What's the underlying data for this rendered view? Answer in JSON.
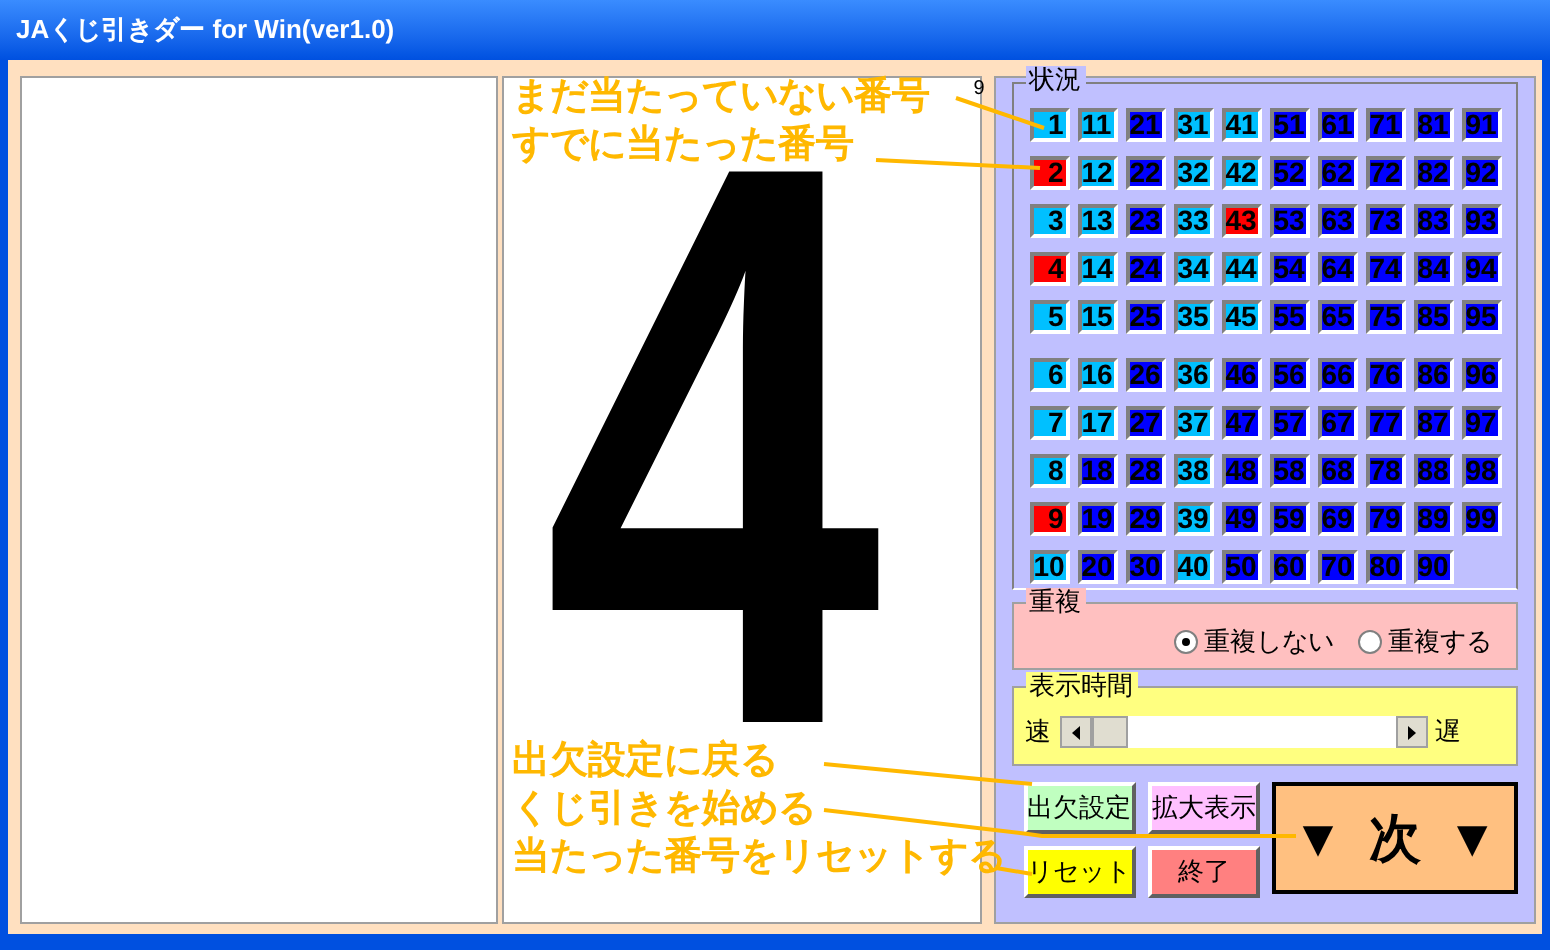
{
  "window": {
    "title": "JAくじ引きダー for Win(ver1.0)"
  },
  "display": {
    "number": "4",
    "edge_label": "9"
  },
  "annotations": [
    {
      "text": "まだ当たっていない番号"
    },
    {
      "text": "すでに当たった番号"
    },
    {
      "text": "出欠設定に戻る"
    },
    {
      "text": "くじ引きを始める"
    },
    {
      "text": "当たった番号をリセットする"
    }
  ],
  "status": {
    "title": "状況",
    "groups": [
      [
        [
          {
            "label": "1",
            "color": "#00c0ff"
          },
          {
            "label": "11",
            "color": "#00c0ff"
          },
          {
            "label": "21",
            "color": "#0000ff"
          },
          {
            "label": "31",
            "color": "#00c0ff"
          },
          {
            "label": "41",
            "color": "#00c0ff"
          },
          {
            "label": "51",
            "color": "#0000ff"
          },
          {
            "label": "61",
            "color": "#0000ff"
          },
          {
            "label": "71",
            "color": "#0000ff"
          },
          {
            "label": "81",
            "color": "#0000ff"
          },
          {
            "label": "91",
            "color": "#0000ff"
          }
        ],
        [
          {
            "label": "2",
            "color": "#ff0000"
          },
          {
            "label": "12",
            "color": "#00c0ff"
          },
          {
            "label": "22",
            "color": "#0000ff"
          },
          {
            "label": "32",
            "color": "#00c0ff"
          },
          {
            "label": "42",
            "color": "#00c0ff"
          },
          {
            "label": "52",
            "color": "#0000ff"
          },
          {
            "label": "62",
            "color": "#0000ff"
          },
          {
            "label": "72",
            "color": "#0000ff"
          },
          {
            "label": "82",
            "color": "#0000ff"
          },
          {
            "label": "92",
            "color": "#0000ff"
          }
        ],
        [
          {
            "label": "3",
            "color": "#00c0ff"
          },
          {
            "label": "13",
            "color": "#00c0ff"
          },
          {
            "label": "23",
            "color": "#0000ff"
          },
          {
            "label": "33",
            "color": "#00c0ff"
          },
          {
            "label": "43",
            "color": "#ff0000"
          },
          {
            "label": "53",
            "color": "#0000ff"
          },
          {
            "label": "63",
            "color": "#0000ff"
          },
          {
            "label": "73",
            "color": "#0000ff"
          },
          {
            "label": "83",
            "color": "#0000ff"
          },
          {
            "label": "93",
            "color": "#0000ff"
          }
        ],
        [
          {
            "label": "4",
            "color": "#ff0000"
          },
          {
            "label": "14",
            "color": "#00c0ff"
          },
          {
            "label": "24",
            "color": "#0000ff"
          },
          {
            "label": "34",
            "color": "#00c0ff"
          },
          {
            "label": "44",
            "color": "#00c0ff"
          },
          {
            "label": "54",
            "color": "#0000ff"
          },
          {
            "label": "64",
            "color": "#0000ff"
          },
          {
            "label": "74",
            "color": "#0000ff"
          },
          {
            "label": "84",
            "color": "#0000ff"
          },
          {
            "label": "94",
            "color": "#0000ff"
          }
        ],
        [
          {
            "label": "5",
            "color": "#00c0ff"
          },
          {
            "label": "15",
            "color": "#00c0ff"
          },
          {
            "label": "25",
            "color": "#0000ff"
          },
          {
            "label": "35",
            "color": "#00c0ff"
          },
          {
            "label": "45",
            "color": "#00c0ff"
          },
          {
            "label": "55",
            "color": "#0000ff"
          },
          {
            "label": "65",
            "color": "#0000ff"
          },
          {
            "label": "75",
            "color": "#0000ff"
          },
          {
            "label": "85",
            "color": "#0000ff"
          },
          {
            "label": "95",
            "color": "#0000ff"
          }
        ]
      ],
      [
        [
          {
            "label": "6",
            "color": "#00c0ff"
          },
          {
            "label": "16",
            "color": "#00c0ff"
          },
          {
            "label": "26",
            "color": "#0000ff"
          },
          {
            "label": "36",
            "color": "#00c0ff"
          },
          {
            "label": "46",
            "color": "#0000ff"
          },
          {
            "label": "56",
            "color": "#0000ff"
          },
          {
            "label": "66",
            "color": "#0000ff"
          },
          {
            "label": "76",
            "color": "#0000ff"
          },
          {
            "label": "86",
            "color": "#0000ff"
          },
          {
            "label": "96",
            "color": "#0000ff"
          }
        ],
        [
          {
            "label": "7",
            "color": "#00c0ff"
          },
          {
            "label": "17",
            "color": "#00c0ff"
          },
          {
            "label": "27",
            "color": "#0000ff"
          },
          {
            "label": "37",
            "color": "#00c0ff"
          },
          {
            "label": "47",
            "color": "#0000ff"
          },
          {
            "label": "57",
            "color": "#0000ff"
          },
          {
            "label": "67",
            "color": "#0000ff"
          },
          {
            "label": "77",
            "color": "#0000ff"
          },
          {
            "label": "87",
            "color": "#0000ff"
          },
          {
            "label": "97",
            "color": "#0000ff"
          }
        ],
        [
          {
            "label": "8",
            "color": "#00c0ff"
          },
          {
            "label": "18",
            "color": "#0000ff"
          },
          {
            "label": "28",
            "color": "#0000ff"
          },
          {
            "label": "38",
            "color": "#00c0ff"
          },
          {
            "label": "48",
            "color": "#0000ff"
          },
          {
            "label": "58",
            "color": "#0000ff"
          },
          {
            "label": "68",
            "color": "#0000ff"
          },
          {
            "label": "78",
            "color": "#0000ff"
          },
          {
            "label": "88",
            "color": "#0000ff"
          },
          {
            "label": "98",
            "color": "#0000ff"
          }
        ],
        [
          {
            "label": "9",
            "color": "#ff0000"
          },
          {
            "label": "19",
            "color": "#0000ff"
          },
          {
            "label": "29",
            "color": "#0000ff"
          },
          {
            "label": "39",
            "color": "#00c0ff"
          },
          {
            "label": "49",
            "color": "#0000ff"
          },
          {
            "label": "59",
            "color": "#0000ff"
          },
          {
            "label": "69",
            "color": "#0000ff"
          },
          {
            "label": "79",
            "color": "#0000ff"
          },
          {
            "label": "89",
            "color": "#0000ff"
          },
          {
            "label": "99",
            "color": "#0000ff"
          }
        ],
        [
          {
            "label": "10",
            "color": "#00c0ff"
          },
          {
            "label": "20",
            "color": "#0000ff"
          },
          {
            "label": "30",
            "color": "#0000ff"
          },
          {
            "label": "40",
            "color": "#00c0ff"
          },
          {
            "label": "50",
            "color": "#0000ff"
          },
          {
            "label": "60",
            "color": "#0000ff"
          },
          {
            "label": "70",
            "color": "#0000ff"
          },
          {
            "label": "80",
            "color": "#0000ff"
          },
          {
            "label": "90",
            "color": "#0000ff"
          }
        ]
      ]
    ]
  },
  "duplicate": {
    "title": "重複",
    "options": [
      {
        "label": "重複しない",
        "selected": true
      },
      {
        "label": "重複する",
        "selected": false
      }
    ]
  },
  "display_time": {
    "title": "表示時間",
    "fast_label": "速",
    "slow_label": "遅",
    "level": 0
  },
  "buttons": [
    {
      "label": "出欠設定",
      "color": "#c0ffc0"
    },
    {
      "label": "拡大表示",
      "color": "#ffc0ff"
    },
    {
      "label": "リセット",
      "color": "#ffff00"
    },
    {
      "label": "終了",
      "color": "#ff8080"
    }
  ],
  "next_button": {
    "left_mark": "▼",
    "label": "次",
    "right_mark": "▼"
  }
}
